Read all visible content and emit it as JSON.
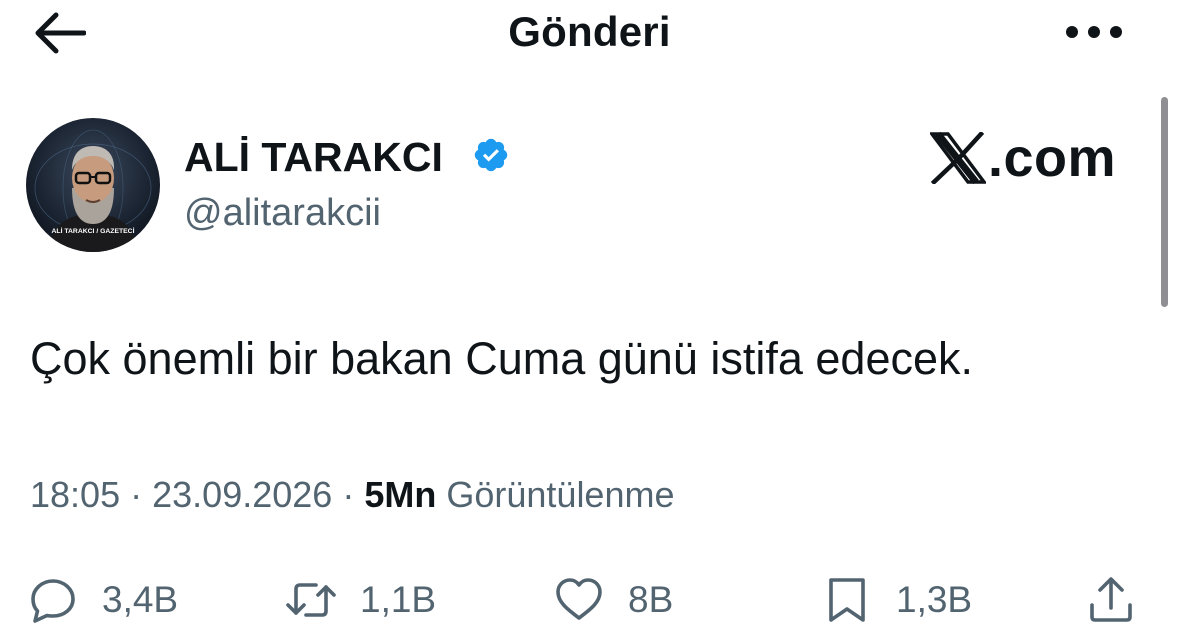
{
  "header": {
    "title": "Gönderi",
    "back_icon": "arrow-left-icon",
    "more_icon": "more-horizontal-icon"
  },
  "author": {
    "display_name": "ALİ TARAKCI",
    "handle": "@alitarakcii",
    "verified": true,
    "verified_color": "#1d9bf0",
    "avatar_caption": "ALİ TARAKCI / GAZETECİ"
  },
  "brand": {
    "text": ".com",
    "icon": "x-logo-icon"
  },
  "tweet": {
    "text": "Çok önemli bir bakan Cuma günü istifa edecek.",
    "time": "18:05",
    "separator": "·",
    "date": "23.09.2026",
    "views_count": "5Mn",
    "views_label": "Görüntülenme"
  },
  "actions": {
    "replies": "3,4B",
    "retweets": "1,1B",
    "likes": "8B",
    "bookmarks": "1,3B"
  },
  "colors": {
    "text": "#0f1419",
    "secondary": "#536471",
    "accent": "#1d9bf0"
  }
}
